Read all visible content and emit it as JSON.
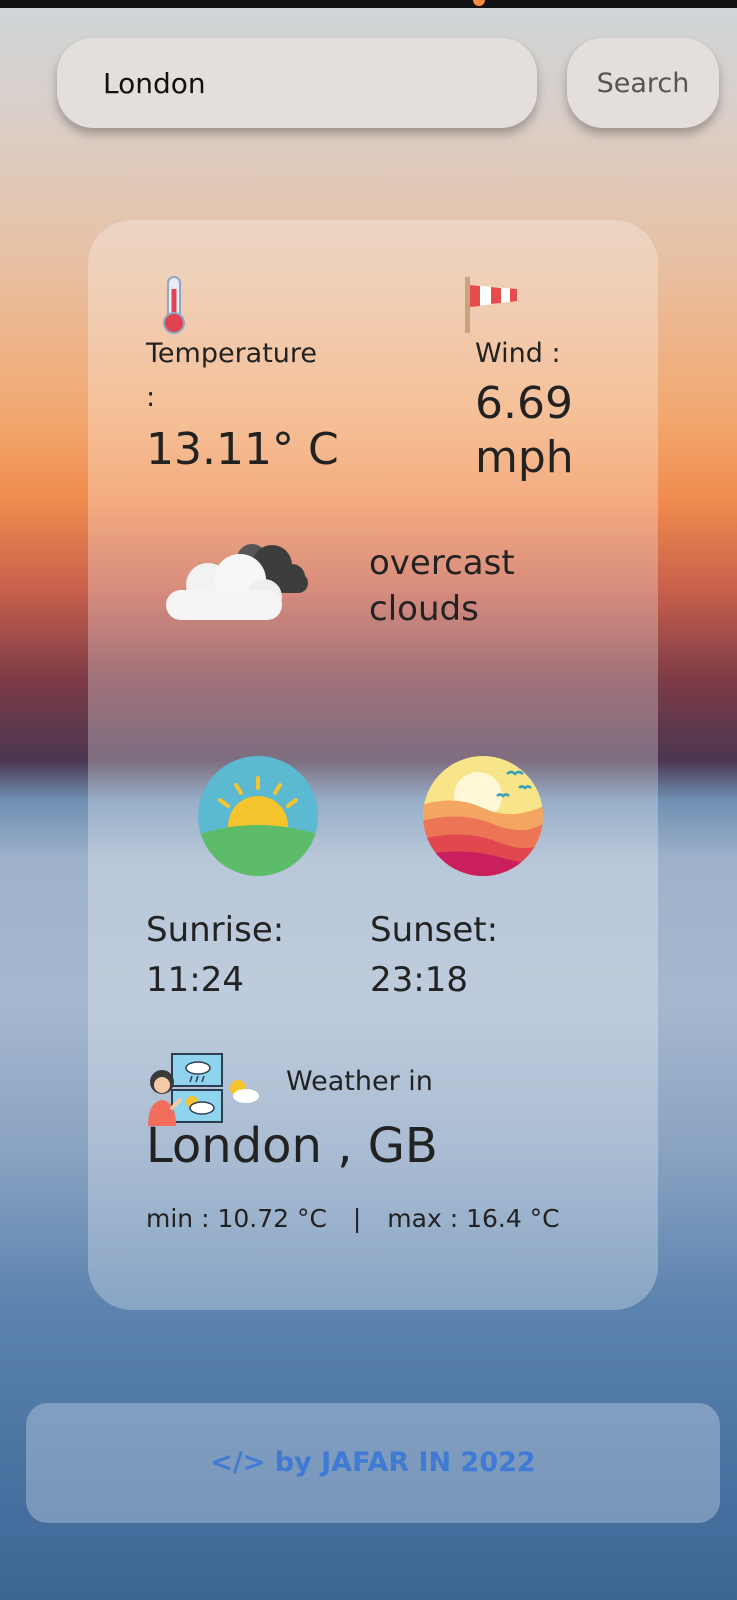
{
  "search": {
    "value": "London",
    "button_label": "Search"
  },
  "temperature": {
    "label": "Temperature",
    "colon": ":",
    "value": "13.11° C"
  },
  "wind": {
    "label": "Wind :",
    "value": "6.69",
    "unit": "mph"
  },
  "condition": {
    "line1": "overcast",
    "line2": "clouds"
  },
  "sunrise": {
    "label": "Sunrise:",
    "time": "11:24"
  },
  "sunset": {
    "label": "Sunset:",
    "time": "23:18"
  },
  "location": {
    "heading": "Weather in",
    "city": "London , GB",
    "min": "min : 10.72 °C",
    "separator": "|",
    "max": "max : 16.4 °C"
  },
  "footer": {
    "credit": "</> by JAFAR IN 2022"
  },
  "colors": {
    "accent": "#3f7ad4",
    "card": "rgba(255,255,255,0.28)"
  }
}
